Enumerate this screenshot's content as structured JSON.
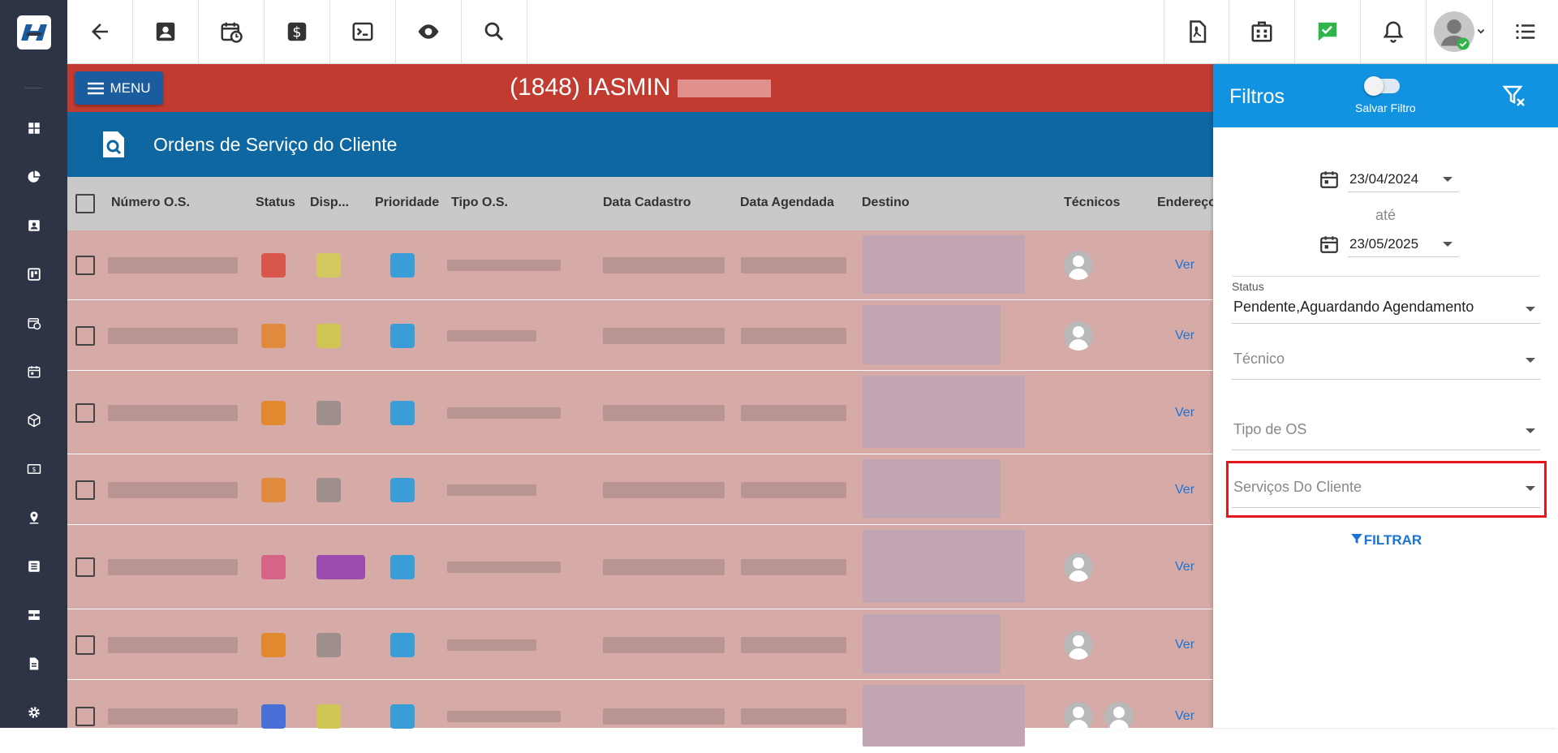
{
  "topbar": {
    "icons": [
      "back-arrow-icon",
      "contact-card-icon",
      "calendar-clock-icon",
      "dollar-icon",
      "terminal-icon",
      "eye-icon",
      "search-icon",
      "pdf-icon",
      "building-icon",
      "check-chat-icon",
      "bell-icon",
      "user-avatar-icon",
      "list-icon"
    ]
  },
  "sidebar": {
    "icons": [
      "dashboard-icon",
      "pie-chart-icon",
      "contact-icon",
      "board-icon",
      "calendar-clock-icon",
      "calendar-check-icon",
      "box-icon",
      "money-icon",
      "location-icon",
      "list-alt-icon",
      "server-icon",
      "document-icon",
      "settings-icon"
    ]
  },
  "menu": {
    "label": "MENU"
  },
  "client": {
    "title": "(1848) IASMIN"
  },
  "page": {
    "title": "Ordens de Serviço do Cliente"
  },
  "table": {
    "columns": [
      "Número O.S.",
      "Status",
      "Disp...",
      "Prioridade",
      "Tipo O.S.",
      "Data Cadastro",
      "Data Agendada",
      "Destino",
      "Técnicos",
      "Endereço"
    ],
    "row_action": "Ver",
    "rows": [
      {
        "status_color": "#d9564d",
        "disp_color": "#d3c85d",
        "prio_color": "#3a9dd8",
        "techs": 1
      },
      {
        "status_color": "#e08a3e",
        "disp_color": "#cfc655",
        "prio_color": "#3a9dd8",
        "techs": 1
      },
      {
        "status_color": "#e0892e",
        "disp_color": "#9e8f8d",
        "prio_color": "#3a9dd8",
        "techs": 0
      },
      {
        "status_color": "#e08a3e",
        "disp_color": "#9e8f8d",
        "prio_color": "#3a9dd8",
        "techs": 0
      },
      {
        "status_color": "#d56487",
        "disp_color": "#9b4bb0",
        "prio_color": "#3a9dd8",
        "techs": 1
      },
      {
        "status_color": "#e0892e",
        "disp_color": "#9e8f8d",
        "prio_color": "#3a9dd8",
        "techs": 1
      },
      {
        "status_color": "#4a6fd6",
        "disp_color": "#cfc655",
        "prio_color": "#3a9dd8",
        "techs": 2
      }
    ]
  },
  "filters": {
    "title": "Filtros",
    "save_filter_label": "Salvar Filtro",
    "date_from": "23/04/2024",
    "date_sep": "até",
    "date_to": "23/05/2025",
    "status_label": "Status",
    "status_value": "Pendente,Aguardando Agendamento",
    "tecnico_placeholder": "Técnico",
    "tipo_os_placeholder": "Tipo de OS",
    "servicos_placeholder": "Serviços Do Cliente",
    "apply_label": "FILTRAR"
  },
  "colors": {
    "sidebar": "#2c3446",
    "client_bar": "#c23b30",
    "page_header": "#0e67a0",
    "panel_header": "#1293e1",
    "highlight": "#e5161c"
  }
}
